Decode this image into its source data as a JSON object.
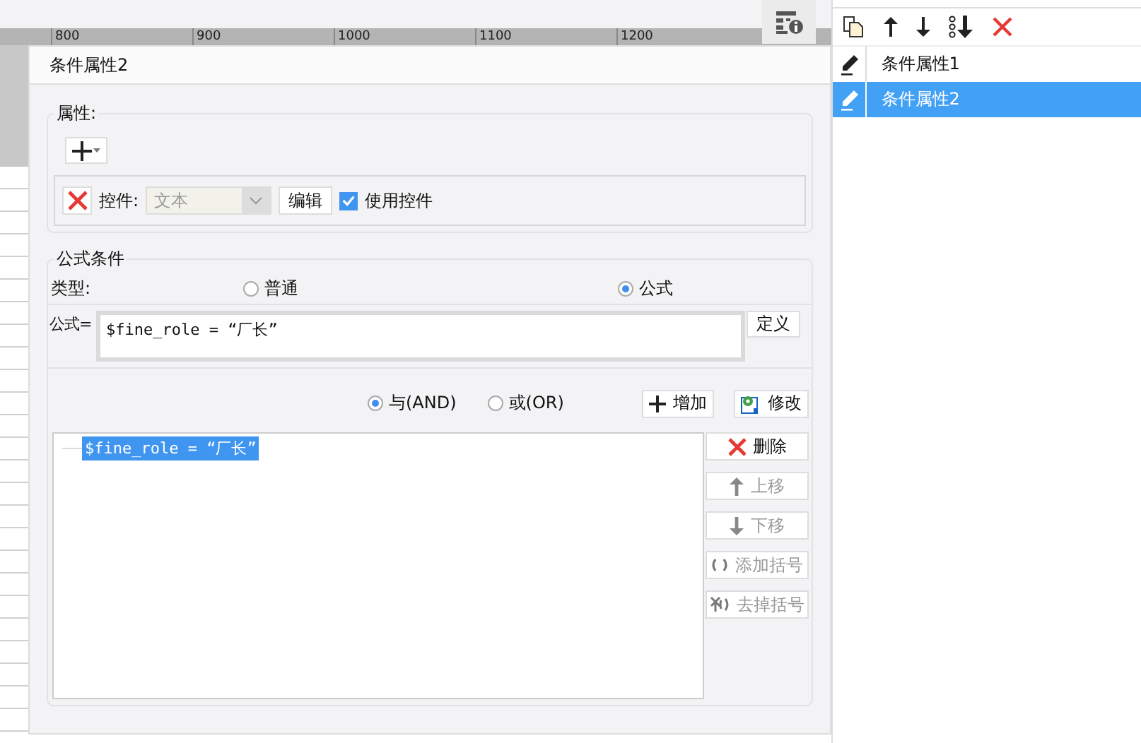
{
  "ruler": {
    "ticks": [
      "800",
      "900",
      "1000",
      "1100",
      "1200"
    ]
  },
  "dialog": {
    "title": "条件属性2",
    "attributes_section": {
      "legend": "属性:",
      "control_row": {
        "label": "控件:",
        "select_value": "文本",
        "select_disabled": true,
        "edit_button": "编辑",
        "use_control": {
          "label": "使用控件",
          "checked": true
        }
      }
    },
    "formula_section": {
      "legend": "公式条件",
      "type_label": "类型:",
      "type_options": [
        {
          "label": "普通",
          "selected": false
        },
        {
          "label": "公式",
          "selected": true
        }
      ],
      "formula_label": "公式=",
      "formula_value": "$fine_role = “厂长”",
      "define_button": "定义",
      "logic_options": [
        {
          "label": "与(AND)",
          "selected": true
        },
        {
          "label": "或(OR)",
          "selected": false
        }
      ],
      "add_button": "增加",
      "modify_button": "修改",
      "conditions": [
        {
          "text": "$fine_role = “厂长”",
          "selected": true
        }
      ],
      "actions": [
        {
          "label": "删除",
          "kind": "delete",
          "disabled": false
        },
        {
          "label": "上移",
          "kind": "up",
          "disabled": true
        },
        {
          "label": "下移",
          "kind": "down",
          "disabled": true
        },
        {
          "label": "添加括号",
          "kind": "add-brackets",
          "disabled": true
        },
        {
          "label": "去掉括号",
          "kind": "remove-brackets",
          "disabled": true
        }
      ]
    }
  },
  "conditions_panel": {
    "items": [
      {
        "label": "条件属性1",
        "selected": false
      },
      {
        "label": "条件属性2",
        "selected": true
      }
    ]
  }
}
